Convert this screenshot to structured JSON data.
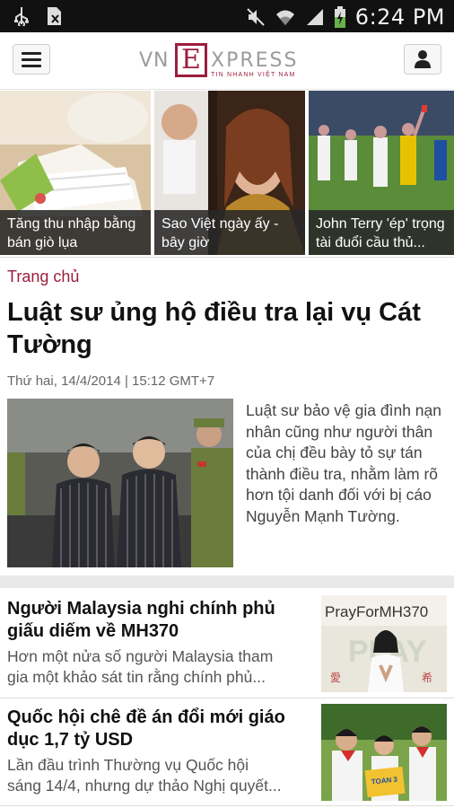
{
  "status_bar": {
    "time": "6:24 PM",
    "left_icons": [
      "usb-icon",
      "sim-card-icon"
    ],
    "right_icons": [
      "mute-icon",
      "wifi-icon",
      "signal-icon",
      "battery-charging-icon"
    ]
  },
  "header": {
    "logo_left": "VN",
    "logo_mid": "E",
    "logo_right": "XPRESS",
    "logo_tagline": "TIN NHANH VIỆT NAM",
    "brand_color": "#9d1e3d"
  },
  "featured": [
    {
      "line1": "Tăng thu nhập bằng",
      "line2": "bán giò lụa"
    },
    {
      "line1": "Sao Việt ngày ấy -",
      "line2": "bây giờ"
    },
    {
      "line1": "John Terry 'ép' trọng",
      "line2": "tài đuổi cầu thủ..."
    }
  ],
  "article": {
    "breadcrumb": "Trang chủ",
    "headline": "Luật sư ủng hộ điều tra lại vụ Cát Tường",
    "dateline": "Thứ hai, 14/4/2014 | 15:12 GMT+7",
    "lead": "Luật sư bảo vệ gia đình nạn nhân cũng như người thân của chị đều bày tỏ sự tán thành điều tra, nhằm làm rõ hơn tội danh đối với bị cáo Nguyễn Mạnh Tường."
  },
  "stories": [
    {
      "title": "Người Malaysia nghi chính phủ giấu diếm về MH370",
      "snippet1": "Hơn một nửa số người Malaysia tham",
      "snippet2": "gia một khảo sát tin rằng chính phủ...",
      "thumb_text": "PrayForMH370"
    },
    {
      "title": "Quốc hội chê đề án đổi mới giáo dục 1,7 tỷ USD",
      "snippet1": "Lần đầu trình Thường vụ Quốc hội",
      "snippet2": "sáng 14/4, nhưng dự thảo Nghị quyết..."
    }
  ]
}
